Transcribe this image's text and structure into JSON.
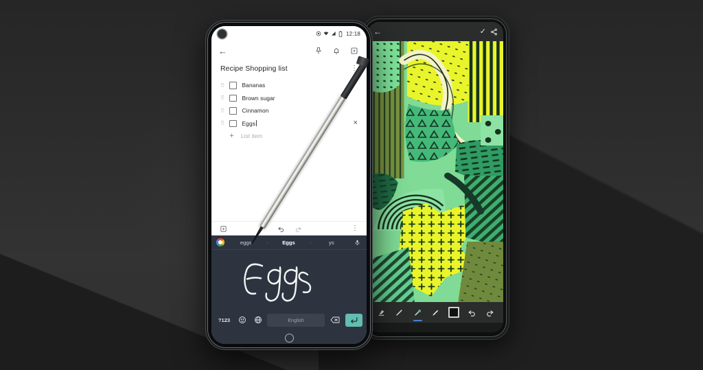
{
  "scene": {
    "description": "Two smartphones on dark gray background; front phone shows Google Keep note with on-screen handwriting keyboard, back phone shows a drawing app with abstract green artwork; a stylus rests diagonally across both."
  },
  "colors": {
    "background": "#2b2b2b",
    "accent_enter_key": "#63bdb0",
    "keyboard_bg": "#2d3440",
    "selected_tool_underline": "#4a7fd4",
    "art_yellow": "#e9f52a",
    "art_green_dark": "#1d4d36",
    "art_green_mid": "#3fae6e",
    "art_green_light": "#8ee6a0",
    "art_olive": "#6f8a3c",
    "art_cream": "#f2f0c4"
  },
  "phone_front": {
    "status_bar": {
      "time": "12:18",
      "icons": [
        "screen-record-icon",
        "wifi-icon",
        "signal-icon",
        "battery-icon"
      ]
    },
    "app_bar": {
      "back_label": "←",
      "icons": [
        "pin-icon",
        "reminder-bell-icon",
        "archive-icon"
      ]
    },
    "note": {
      "title": "Recipe Shopping list",
      "overflow_label": "⋮",
      "items": [
        {
          "text": "Bananas",
          "checked": false
        },
        {
          "text": "Brown sugar",
          "checked": false
        },
        {
          "text": "Cinnamon",
          "checked": false
        },
        {
          "text": "Eggs",
          "checked": false,
          "editing": true
        }
      ],
      "add_item_placeholder": "List item",
      "add_item_plus": "+",
      "close_label": "×"
    },
    "note_toolbar": {
      "add_box_icon": "add-box-icon",
      "undo_icon": "undo-icon",
      "redo_icon": "redo-icon",
      "overflow_label": "⋮"
    },
    "keyboard": {
      "suggestions": [
        "eggs",
        "Eggs",
        "ys"
      ],
      "selected_suggestion": "Eggs",
      "google_logo": "google-g-icon",
      "mic_icon": "microphone-icon",
      "handwriting_text": "Eggs",
      "bottom_row": {
        "symbols_key": "?123",
        "emoji_key": "emoji-icon",
        "language_key": "globe-icon",
        "space_key": "English",
        "backspace_key": "backspace-icon",
        "enter_key": "enter-icon"
      }
    },
    "nav_bar": {
      "home_button": "home-button"
    }
  },
  "phone_back": {
    "top_bar": {
      "back_label": "←",
      "done_label": "✓",
      "share_label": "share-icon"
    },
    "canvas": {
      "content": "abstract green and yellow patterned artwork"
    },
    "toolbar": {
      "tools": [
        {
          "name": "eraser-tool",
          "selected": false
        },
        {
          "name": "pen-tool",
          "selected": false
        },
        {
          "name": "highlighter-tool",
          "selected": true
        },
        {
          "name": "brush-tool",
          "selected": false
        },
        {
          "name": "color-swatch",
          "selected": false,
          "color": "#111111"
        },
        {
          "name": "undo-tool",
          "selected": false
        },
        {
          "name": "redo-tool",
          "selected": false
        }
      ]
    }
  }
}
